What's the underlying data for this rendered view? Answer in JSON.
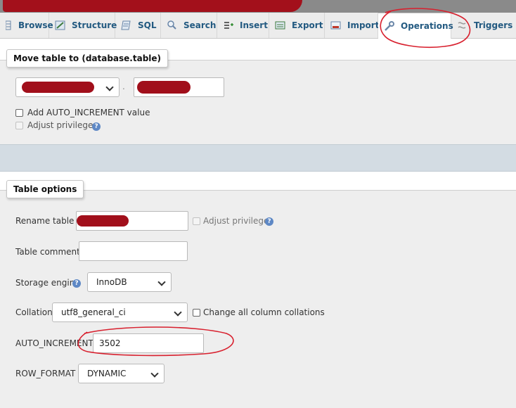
{
  "tabs": [
    {
      "label": "Browse",
      "icon": "browse-icon"
    },
    {
      "label": "Structure",
      "icon": "structure-icon"
    },
    {
      "label": "SQL",
      "icon": "sql-icon"
    },
    {
      "label": "Search",
      "icon": "search-icon"
    },
    {
      "label": "Insert",
      "icon": "insert-icon"
    },
    {
      "label": "Export",
      "icon": "export-icon"
    },
    {
      "label": "Import",
      "icon": "import-icon"
    },
    {
      "label": "Operations",
      "icon": "wrench-icon",
      "active": true
    },
    {
      "label": "Triggers",
      "icon": "triggers-icon"
    }
  ],
  "move_table": {
    "legend": "Move table to (database.table)",
    "separator": ".",
    "add_auto_increment_label": "Add AUTO_INCREMENT value",
    "adjust_privileges_label": "Adjust privileges",
    "help_glyph": "?"
  },
  "table_options": {
    "legend": "Table options",
    "rename_label": "Rename table to",
    "adjust_privileges_label": "Adjust privileges",
    "comments_label": "Table comments",
    "comments_value": "",
    "storage_engine_label": "Storage engine",
    "storage_engine_value": "InnoDB",
    "collation_label": "Collation",
    "collation_value": "utf8_general_ci",
    "change_collations_label": "Change all column collations",
    "auto_increment_label": "AUTO_INCREMENT",
    "auto_increment_value": "3502",
    "row_format_label": "ROW_FORMAT",
    "row_format_value": "DYNAMIC",
    "help_glyph": "?"
  },
  "colors": {
    "tab_text": "#235a81",
    "panel_bg": "#eeeeee",
    "submit_bar": "#d3dce3",
    "annotation_red": "#d8202e",
    "redaction": "#a10f1b"
  }
}
